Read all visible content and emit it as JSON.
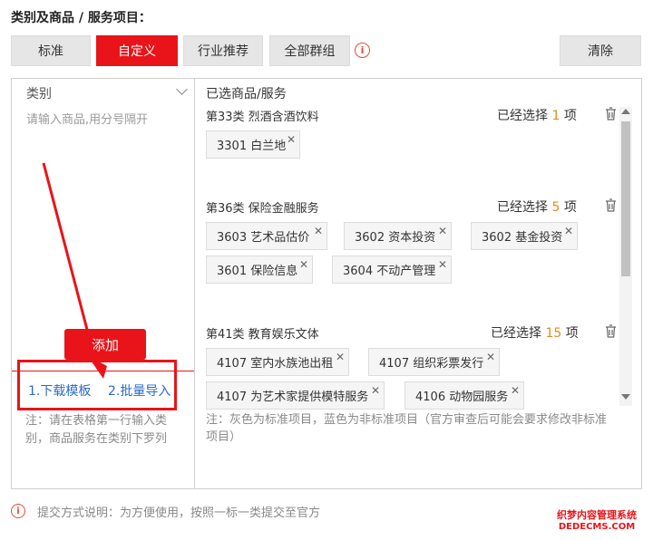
{
  "section_title": "类别及商品 / 服务项目：",
  "tabs": [
    {
      "label": "标准",
      "active": false
    },
    {
      "label": "自定义",
      "active": true
    },
    {
      "label": "行业推荐",
      "active": false
    },
    {
      "label": "全部群组",
      "active": false
    }
  ],
  "clear_label": "清除",
  "left": {
    "category_label": "类别",
    "input_placeholder": "请输入商品,用分号隔开",
    "add_label": "添加",
    "download_link": "1.下载模板",
    "import_link": "2.批量导入",
    "note": "注：请在表格第一行输入类别，商品服务在类别下罗列"
  },
  "selected_title": "已选商品/服务",
  "groups": [
    {
      "title": "第33类 烈酒含酒饮料",
      "count_prefix": "已经选择",
      "count": "1",
      "count_suffix": "项",
      "tags": [
        "3301 白兰地"
      ]
    },
    {
      "title": "第36类 保险金融服务",
      "count_prefix": "已经选择",
      "count": "5",
      "count_suffix": "项",
      "tags": [
        "3603 艺术品估价",
        "3602 资本投资",
        "3602 基金投资",
        "3601 保险信息",
        "3604 不动产管理"
      ]
    },
    {
      "title": "第41类 教育娱乐文体",
      "count_prefix": "已经选择",
      "count": "15",
      "count_suffix": "项",
      "tags": [
        "4107 室内水族池出租",
        "4107 组织彩票发行",
        "4107 为艺术家提供模特服务",
        "4106 动物园服务"
      ]
    }
  ],
  "right_note": "注：灰色为标准项目，蓝色为非标准项目（官方审查后可能会要求修改非标准项目）",
  "footer_text": "提交方式说明：为方便使用，按照一标一类提交至官方",
  "watermark": {
    "line1": "织梦内容管理系统",
    "line2": "DEDECMS.COM"
  },
  "colors": {
    "accent": "#e8141a",
    "count": "#e58a1f",
    "link": "#2a6cc9"
  },
  "icons": [
    "info-icon",
    "chevron-down-icon",
    "trash-icon",
    "close-icon",
    "arrow-annotation"
  ]
}
